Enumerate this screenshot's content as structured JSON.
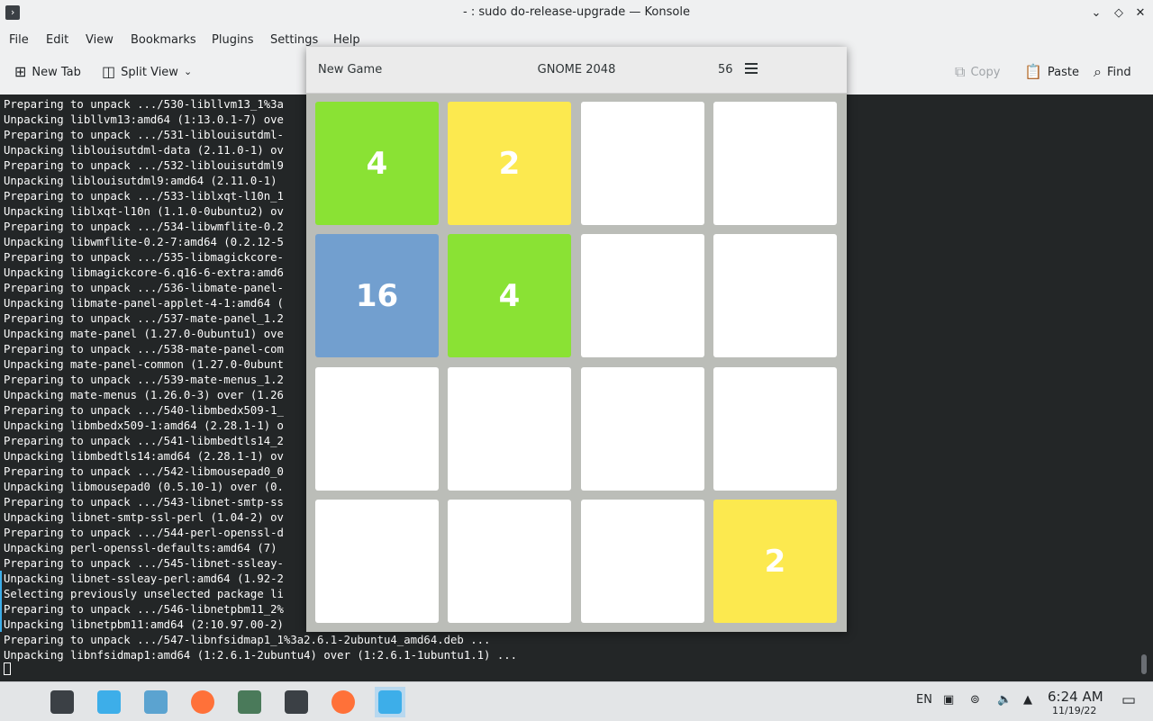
{
  "window": {
    "title": "- : sudo do-release-upgrade — Konsole"
  },
  "menu": [
    "File",
    "Edit",
    "View",
    "Bookmarks",
    "Plugins",
    "Settings",
    "Help"
  ],
  "toolbar": {
    "new_tab": "New Tab",
    "split_view": "Split View",
    "copy": "Copy",
    "paste": "Paste",
    "find": "Find"
  },
  "terminal": {
    "lines": [
      "Preparing to unpack .../530-libllvm13_1%3a",
      "Unpacking libllvm13:amd64 (1:13.0.1-7) ove",
      "Preparing to unpack .../531-liblouisutdml-",
      "Unpacking liblouisutdml-data (2.11.0-1) ov",
      "Preparing to unpack .../532-liblouisutdml9",
      "Unpacking liblouisutdml9:amd64 (2.11.0-1) ",
      "Preparing to unpack .../533-liblxqt-l10n_1",
      "Unpacking liblxqt-l10n (1.1.0-0ubuntu2) ov",
      "Preparing to unpack .../534-libwmflite-0.2",
      "Unpacking libwmflite-0.2-7:amd64 (0.2.12-5",
      "Preparing to unpack .../535-libmagickcore-",
      "Unpacking libmagickcore-6.q16-6-extra:amd6",
      "Preparing to unpack .../536-libmate-panel-",
      "Unpacking libmate-panel-applet-4-1:amd64 (",
      "Preparing to unpack .../537-mate-panel_1.2",
      "Unpacking mate-panel (1.27.0-0ubuntu1) ove",
      "Preparing to unpack .../538-mate-panel-com",
      "Unpacking mate-panel-common (1.27.0-0ubunt",
      "Preparing to unpack .../539-mate-menus_1.2",
      "Unpacking mate-menus (1.26.0-3) over (1.26",
      "Preparing to unpack .../540-libmbedx509-1_",
      "Unpacking libmbedx509-1:amd64 (2.28.1-1) o",
      "Preparing to unpack .../541-libmbedtls14_2",
      "Unpacking libmbedtls14:amd64 (2.28.1-1) ov",
      "Preparing to unpack .../542-libmousepad0_0",
      "Unpacking libmousepad0 (0.5.10-1) over (0.",
      "Preparing to unpack .../543-libnet-smtp-ss",
      "Unpacking libnet-smtp-ssl-perl (1.04-2) ov",
      "Preparing to unpack .../544-perl-openssl-d",
      "Unpacking perl-openssl-defaults:amd64 (7) ",
      "Preparing to unpack .../545-libnet-ssleay-",
      "Unpacking libnet-ssleay-perl:amd64 (1.92-2",
      "Selecting previously unselected package li",
      "Preparing to unpack .../546-libnetpbm11_2%",
      "Unpacking libnetpbm11:amd64 (2:10.97.00-2)",
      "Preparing to unpack .../547-libnfsidmap1_1%3a2.6.1-2ubuntu4_amd64.deb ...",
      "Unpacking libnfsidmap1:amd64 (1:2.6.1-2ubuntu4) over (1:2.6.1-1ubuntu1.1) ..."
    ]
  },
  "game": {
    "new_game": "New Game",
    "title": "GNOME 2048",
    "score": "56",
    "tiles": [
      {
        "value": "4",
        "color": "#8ae234"
      },
      {
        "value": "2",
        "color": "#fce94f"
      },
      {
        "value": "",
        "color": "#ffffff"
      },
      {
        "value": "",
        "color": "#ffffff"
      },
      {
        "value": "16",
        "color": "#729fcf"
      },
      {
        "value": "4",
        "color": "#8ae234"
      },
      {
        "value": "",
        "color": "#ffffff"
      },
      {
        "value": "",
        "color": "#ffffff"
      },
      {
        "value": "",
        "color": "#ffffff"
      },
      {
        "value": "",
        "color": "#ffffff"
      },
      {
        "value": "",
        "color": "#ffffff"
      },
      {
        "value": "",
        "color": "#ffffff"
      },
      {
        "value": "",
        "color": "#ffffff"
      },
      {
        "value": "",
        "color": "#ffffff"
      },
      {
        "value": "",
        "color": "#ffffff"
      },
      {
        "value": "2",
        "color": "#fce94f"
      }
    ]
  },
  "taskbar": {
    "apps": [
      {
        "name": "app-launcher-icon",
        "color": "#e3e5e7"
      },
      {
        "name": "system-settings-icon",
        "color": "#3b4045"
      },
      {
        "name": "discover-store-icon",
        "color": "#3daee9"
      },
      {
        "name": "file-manager-icon",
        "color": "#5ba3d0"
      },
      {
        "name": "firefox-icon",
        "color": "#ff7139"
      },
      {
        "name": "spectacle-icon",
        "color": "#4a7a5a"
      },
      {
        "name": "konsole-icon",
        "color": "#3b4045"
      },
      {
        "name": "firefox-icon",
        "color": "#ff7139"
      },
      {
        "name": "gnome-2048-icon",
        "color": "#3daee9"
      }
    ],
    "language": "EN",
    "time": "6:24 AM",
    "date": "11/19/22"
  }
}
